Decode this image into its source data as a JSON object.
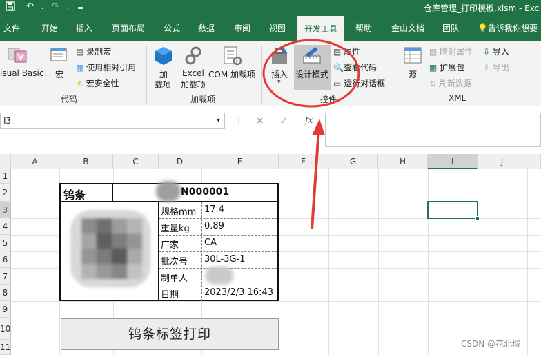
{
  "titlebar": {
    "doc_title": "仓库管理_打印模板.xlsm - Exc",
    "save_icon": "save-icon",
    "undo_icon": "undo-icon",
    "redo_icon": "redo-icon"
  },
  "tabs": [
    "文件",
    "开始",
    "插入",
    "页面布局",
    "公式",
    "数据",
    "审阅",
    "视图",
    "开发工具",
    "帮助",
    "金山文档",
    "团队",
    "告诉我你想要"
  ],
  "active_tab": "开发工具",
  "ribbon": {
    "code": {
      "visual_basic": "isual Basic",
      "macro": "宏",
      "record_macro": "录制宏",
      "relative_ref": "使用相对引用",
      "macro_security": "宏安全性",
      "label": "代码"
    },
    "addins": {
      "addin": "加\n载项",
      "addin_l1": "加",
      "addin_l2": "载项",
      "excel_addin_l1": "Excel",
      "excel_addin_l2": "加载项",
      "com_addin": "COM 加载项",
      "label": "加载项"
    },
    "controls": {
      "insert": "插入",
      "design_mode": "设计模式",
      "properties": "属性",
      "view_code": "查看代码",
      "run_dialog": "运行对话框",
      "label": "控件"
    },
    "xml": {
      "source": "源",
      "map_props": "映射属性",
      "ext_pack": "扩展包",
      "refresh": "刷新数据",
      "import": "导入",
      "export": "导出",
      "label": "XML"
    }
  },
  "formula_bar": {
    "name_box": "I3",
    "cancel_icon": "x-icon",
    "enter_icon": "check-icon",
    "fx_label": "fx"
  },
  "columns": [
    "A",
    "B",
    "C",
    "D",
    "E",
    "F",
    "G",
    "H",
    "I",
    "J"
  ],
  "selected_column": "I",
  "rows": [
    "1",
    "2",
    "3",
    "4",
    "5",
    "6",
    "7",
    "8",
    "9",
    "10",
    "11"
  ],
  "selected_row": "3",
  "label_sheet": {
    "product": "钨条",
    "code_suffix": "N000001",
    "fields": [
      {
        "label": "规格mm",
        "value": "17.4"
      },
      {
        "label": "重量kg",
        "value": "0.89"
      },
      {
        "label": "厂家",
        "value": "CA"
      },
      {
        "label": "批次号",
        "value": "30L-3G-1"
      },
      {
        "label": "制单人",
        "value": ""
      },
      {
        "label": "日期",
        "value": "2023/2/3 16:43"
      }
    ]
  },
  "print_button": "钨条标签打印",
  "watermark": "CSDN @花北城",
  "colors": {
    "excel_green": "#217346",
    "annotation_red": "#e53935"
  }
}
